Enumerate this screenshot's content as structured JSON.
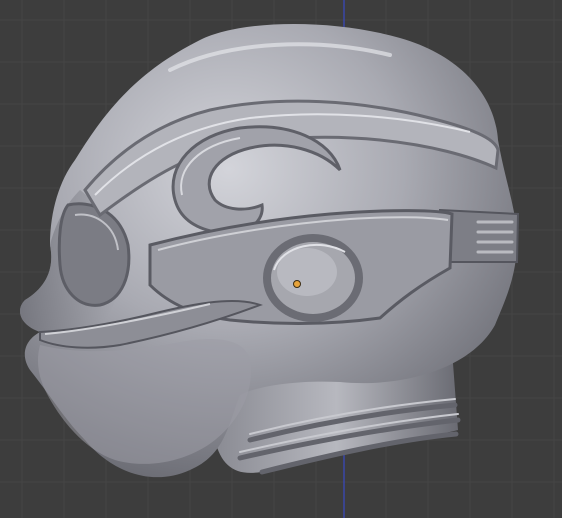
{
  "viewport": {
    "background_color": "#3d3d3d",
    "grid_color": "#454545",
    "axis_color": "#3a47a8",
    "model_base_color": "#9d9ea6",
    "model_highlight_color": "#d3d4da",
    "model_shadow_color": "#55565e",
    "origin_color": "#e7a33a",
    "model": {
      "object": "sculpted-helmet-skull-mesh",
      "features": [
        "cranium",
        "brow-ridge",
        "eye-socket",
        "ear-disc",
        "side-vent",
        "jaw",
        "neck-rings"
      ]
    },
    "origin_marker": {
      "icon": "object-origin-dot"
    }
  }
}
